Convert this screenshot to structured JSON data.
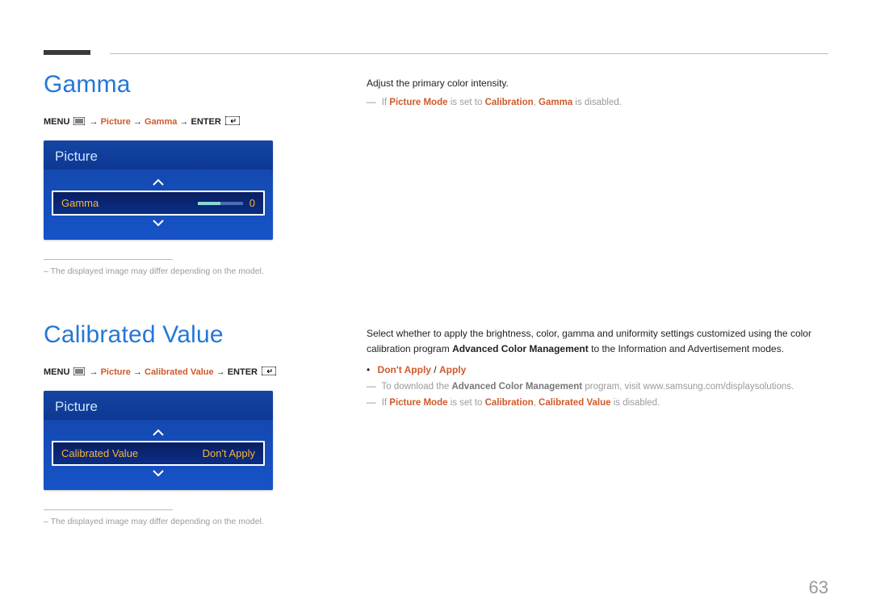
{
  "page_number": "63",
  "section1": {
    "title": "Gamma",
    "breadcrumb": {
      "menu": "MENU",
      "sep": "→",
      "part1": "Picture",
      "part2": "Gamma",
      "enter": "ENTER"
    },
    "ui": {
      "header": "Picture",
      "row_label": "Gamma",
      "row_value": "0"
    },
    "footnote": "– The displayed image may differ depending on the model.",
    "description": "Adjust the primary color intensity.",
    "note": {
      "prefix": "If",
      "pm": "Picture Mode",
      "mid": "is set to",
      "cal": "Calibration",
      "g": "Gamma",
      "suffix": "is disabled."
    }
  },
  "section2": {
    "title": "Calibrated Value",
    "breadcrumb": {
      "menu": "MENU",
      "sep": "→",
      "part1": "Picture",
      "part2": "Calibrated Value",
      "enter": "ENTER"
    },
    "ui": {
      "header": "Picture",
      "row_label": "Calibrated Value",
      "row_value": "Don't Apply"
    },
    "footnote": "– The displayed image may differ depending on the model.",
    "description": "Select whether to apply the brightness, color, gamma and uniformity settings customized using the color calibration program",
    "description2_bold": "Advanced Color Management",
    "description2_rest": "to the Information and Advertisement modes.",
    "options": {
      "a": "Don't Apply",
      "sep": "/",
      "b": "Apply"
    },
    "dl_note": {
      "pre": "To download the",
      "acm": "Advanced Color Management",
      "post": "program, visit www.samsung.com/displaysolutions."
    },
    "note": {
      "prefix": "If",
      "pm": "Picture Mode",
      "mid": "is set to",
      "cal": "Calibration",
      "cv": "Calibrated Value",
      "suffix": "is disabled."
    }
  }
}
